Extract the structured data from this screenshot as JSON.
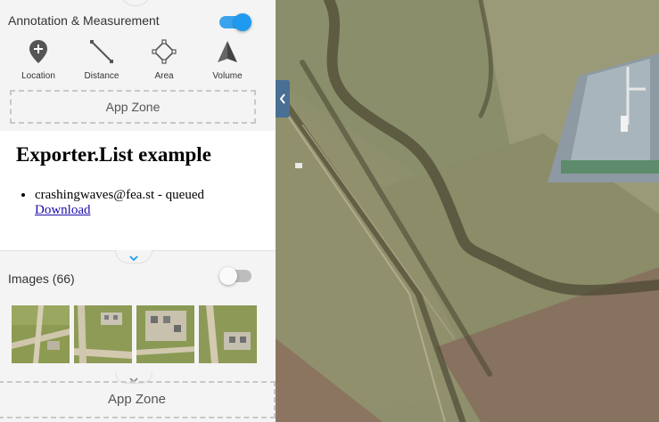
{
  "annotation": {
    "title": "Annotation & Measurement",
    "toggle_on": true,
    "tools": [
      {
        "label": "Location",
        "icon": "location-pin-icon"
      },
      {
        "label": "Distance",
        "icon": "distance-ruler-icon"
      },
      {
        "label": "Area",
        "icon": "area-polygon-icon"
      },
      {
        "label": "Volume",
        "icon": "volume-pyramid-icon"
      }
    ]
  },
  "app_zone_top": {
    "label": "App Zone"
  },
  "exporter": {
    "heading": "Exporter.List example",
    "items": [
      {
        "text": "crashingwaves@fea.st - queued",
        "link": "Download"
      }
    ]
  },
  "images": {
    "title": "Images (66)",
    "toggle_on": false
  },
  "app_zone_bottom": {
    "label": "App Zone"
  },
  "colors": {
    "accent": "#1e9bf0",
    "map_handle": "#4a6f95",
    "sidebar_bg": "#f4f4f4"
  }
}
